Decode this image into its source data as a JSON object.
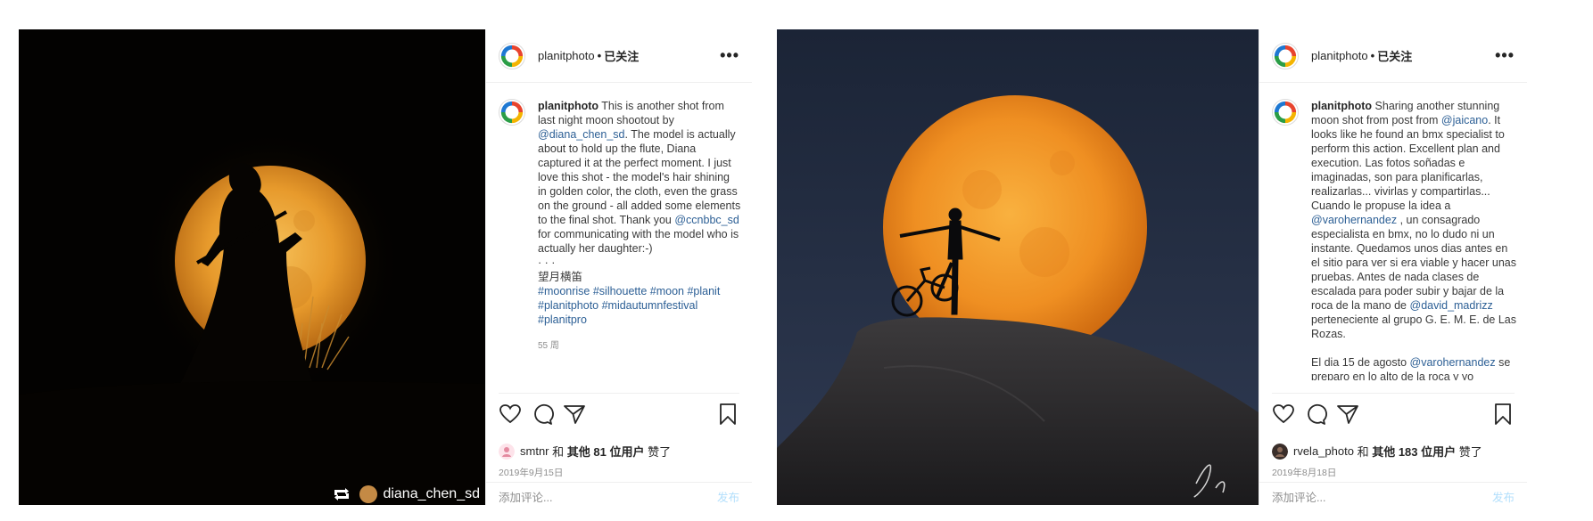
{
  "colors": {
    "link": "#2c5f95",
    "muted": "#8e8e8e",
    "publish": "#b2dffc"
  },
  "post1": {
    "photo": {
      "repost_user": "diana_chen_sd",
      "repost_icon": "repost-arrows-icon"
    },
    "header": {
      "username": "planitphoto",
      "dot": "•",
      "follow_status": "已关注",
      "more": "•••"
    },
    "caption": {
      "username": "planitphoto",
      "p1": "This is another shot from last night moon shootout by",
      "mention1": "@diana_chen_sd",
      "p2": ". The model is actually about to hold up the flute, Diana captured it at the perfect moment. I just love this shot - the model's hair shining in golden color, the cloth, even the grass on the ground - all added some elements to the final shot. Thank you",
      "mention2": "@ccnbbc_sd",
      "p3": "for communicating with the model who is actually her daughter:-)",
      "dots": "· · ·",
      "title_cn": "望月横笛",
      "hashtags": "#moonrise #silhouette #moon #planit #planitphoto #midautumnfestival #planitpro",
      "time": "55 周"
    },
    "likes": {
      "user": "smtnr",
      "and": "和",
      "others": "其他 81 位用户",
      "liked": "赞了"
    },
    "date": "2019年9月15日",
    "comment": {
      "placeholder": "添加评论...",
      "publish": "发布"
    }
  },
  "post2": {
    "header": {
      "username": "planitphoto",
      "dot": "•",
      "follow_status": "已关注",
      "more": "•••"
    },
    "caption": {
      "username": "planitphoto",
      "p1": "Sharing another stunning moon shot from post from",
      "mention1": "@jaicano",
      "p2": ". It looks like he found an bmx specialist to perform this action. Excellent plan and execution. Las fotos soñadas e imaginadas, son para planificarlas, realizarlas... vivirlas y compartirlas... Cuando le propuse la idea a",
      "mention2": "@varohernandez",
      "p3": ", un consagrado especialista en bmx, no lo dudo ni un instante. Quedamos unos dias antes en el sitio para ver si era viable y hacer unas pruebas. Antes de nada clases de escalada para poder subir y bajar de la roca de la mano de",
      "mention3": "@david_madrizz",
      "p4": "perteneciente al grupo G. E. M. E. de Las Rozas.",
      "p5": "El dia 15 de agosto",
      "mention4": "@varohernandez",
      "p6": "se preparo en lo alto de la roca y yo"
    },
    "likes": {
      "user": "rvela_photo",
      "and": "和",
      "others": "其他 183 位用户",
      "liked": "赞了"
    },
    "date": "2019年8月18日",
    "comment": {
      "placeholder": "添加评论...",
      "publish": "发布"
    }
  }
}
